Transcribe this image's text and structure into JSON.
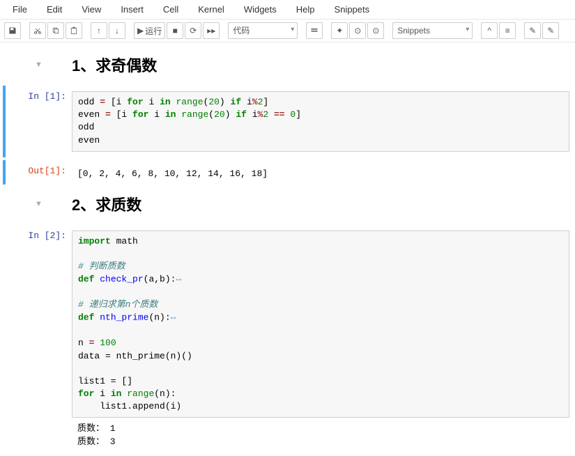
{
  "menu": {
    "items": [
      "File",
      "Edit",
      "View",
      "Insert",
      "Cell",
      "Kernel",
      "Widgets",
      "Help",
      "Snippets"
    ]
  },
  "toolbar": {
    "run_label": "运行",
    "celltype": "代码",
    "snippets": "Snippets"
  },
  "heading1": "1、求奇偶数",
  "heading2": "2、求质数",
  "cell1": {
    "in_prompt": "In  [1]:",
    "out_prompt": "Out[1]:",
    "code": {
      "l1a": "odd ",
      "l1b": "=",
      "l1c": " [i ",
      "l1d": "for",
      "l1e": " i ",
      "l1f": "in",
      "l1g": " ",
      "l1h": "range",
      "l1i": "(",
      "l1j": "20",
      "l1k": ") ",
      "l1l": "if",
      "l1m": " i",
      "l1n": "%",
      "l1o": "2",
      "l1p": "]",
      "l2a": "even ",
      "l2b": "=",
      "l2c": " [i ",
      "l2d": "for",
      "l2e": " i ",
      "l2f": "in",
      "l2g": " ",
      "l2h": "range",
      "l2i": "(",
      "l2j": "20",
      "l2k": ") ",
      "l2l": "if",
      "l2m": " i",
      "l2n": "%",
      "l2o": "2",
      "l2p": " ",
      "l2q": "==",
      "l2r": " ",
      "l2s": "0",
      "l2t": "]",
      "l3": "odd",
      "l4": "even"
    },
    "output": "[0, 2, 4, 6, 8, 10, 12, 14, 16, 18]"
  },
  "cell2": {
    "in_prompt": "In  [2]:",
    "code": {
      "l1a": "import",
      "l1b": " math",
      "c1": "# 判断质数",
      "d1a": "def",
      "d1b": " ",
      "d1c": "check_pr",
      "d1d": "(a,b):",
      "c2": "# 递归求第n个质数",
      "d2a": "def",
      "d2b": " ",
      "d2c": "nth_prime",
      "d2d": "(n):",
      "l5a": "n ",
      "l5b": "=",
      "l5c": " ",
      "l5d": "100",
      "l6": "data = nth_prime(n)()",
      "l7": "list1 = []",
      "l8a": "for",
      "l8b": " i ",
      "l8c": "in",
      "l8d": " ",
      "l8e": "range",
      "l8f": "(n):",
      "l9": "    list1.append(i)"
    },
    "output": "质数： 1\n质数： 3"
  }
}
